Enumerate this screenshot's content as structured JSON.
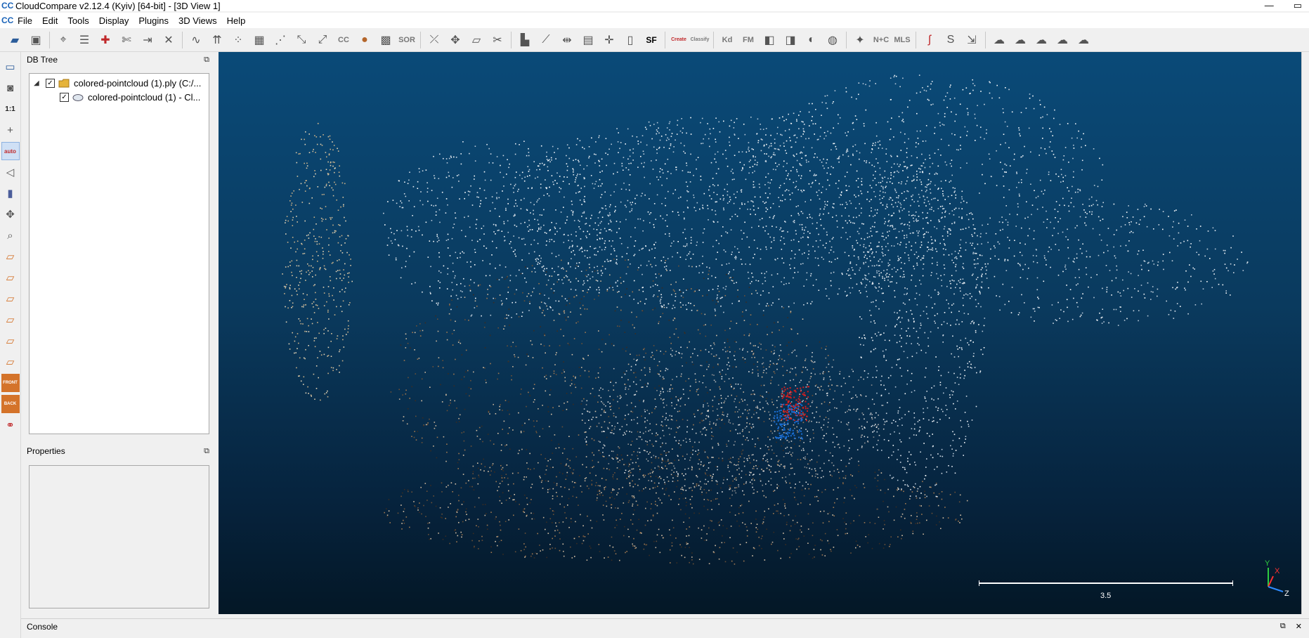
{
  "window": {
    "title": "CloudCompare v2.12.4 (Kyiv) [64-bit] - [3D View 1]",
    "logo": "CC",
    "min_glyph": "—",
    "max_glyph": "▭"
  },
  "menu": [
    "File",
    "Edit",
    "Tools",
    "Display",
    "Plugins",
    "3D Views",
    "Help"
  ],
  "toolbar_labels": {
    "cc": "CC",
    "sor": "SOR",
    "sf": "SF",
    "kd": "Kd",
    "fm": "FM",
    "nc": "N+C",
    "mls": "MLS",
    "canupo_create": "Create",
    "canupo_classify": "Classify"
  },
  "left_toolbar": {
    "one_to_one": "1:1",
    "auto": "auto",
    "front": "FRONT",
    "back": "BACK"
  },
  "db_tree": {
    "title": "DB Tree",
    "items": [
      {
        "label": "colored-pointcloud (1).ply (C:/...",
        "checked": "✓",
        "expander": "◢",
        "icon": "folder-icon"
      },
      {
        "label": "colored-pointcloud (1) - Cl...",
        "checked": "✓",
        "icon": "cloud-icon"
      }
    ]
  },
  "properties": {
    "title": "Properties"
  },
  "view": {
    "scale_label": "3.5",
    "axis_x": "X",
    "axis_y": "Y",
    "axis_z": "Z"
  },
  "console": {
    "title": "Console",
    "float_glyph": "⧉",
    "close_glyph": "✕"
  },
  "colors": {
    "view_top": "#0a4a78",
    "view_bottom": "#041726",
    "accent": "#1a63b8"
  }
}
